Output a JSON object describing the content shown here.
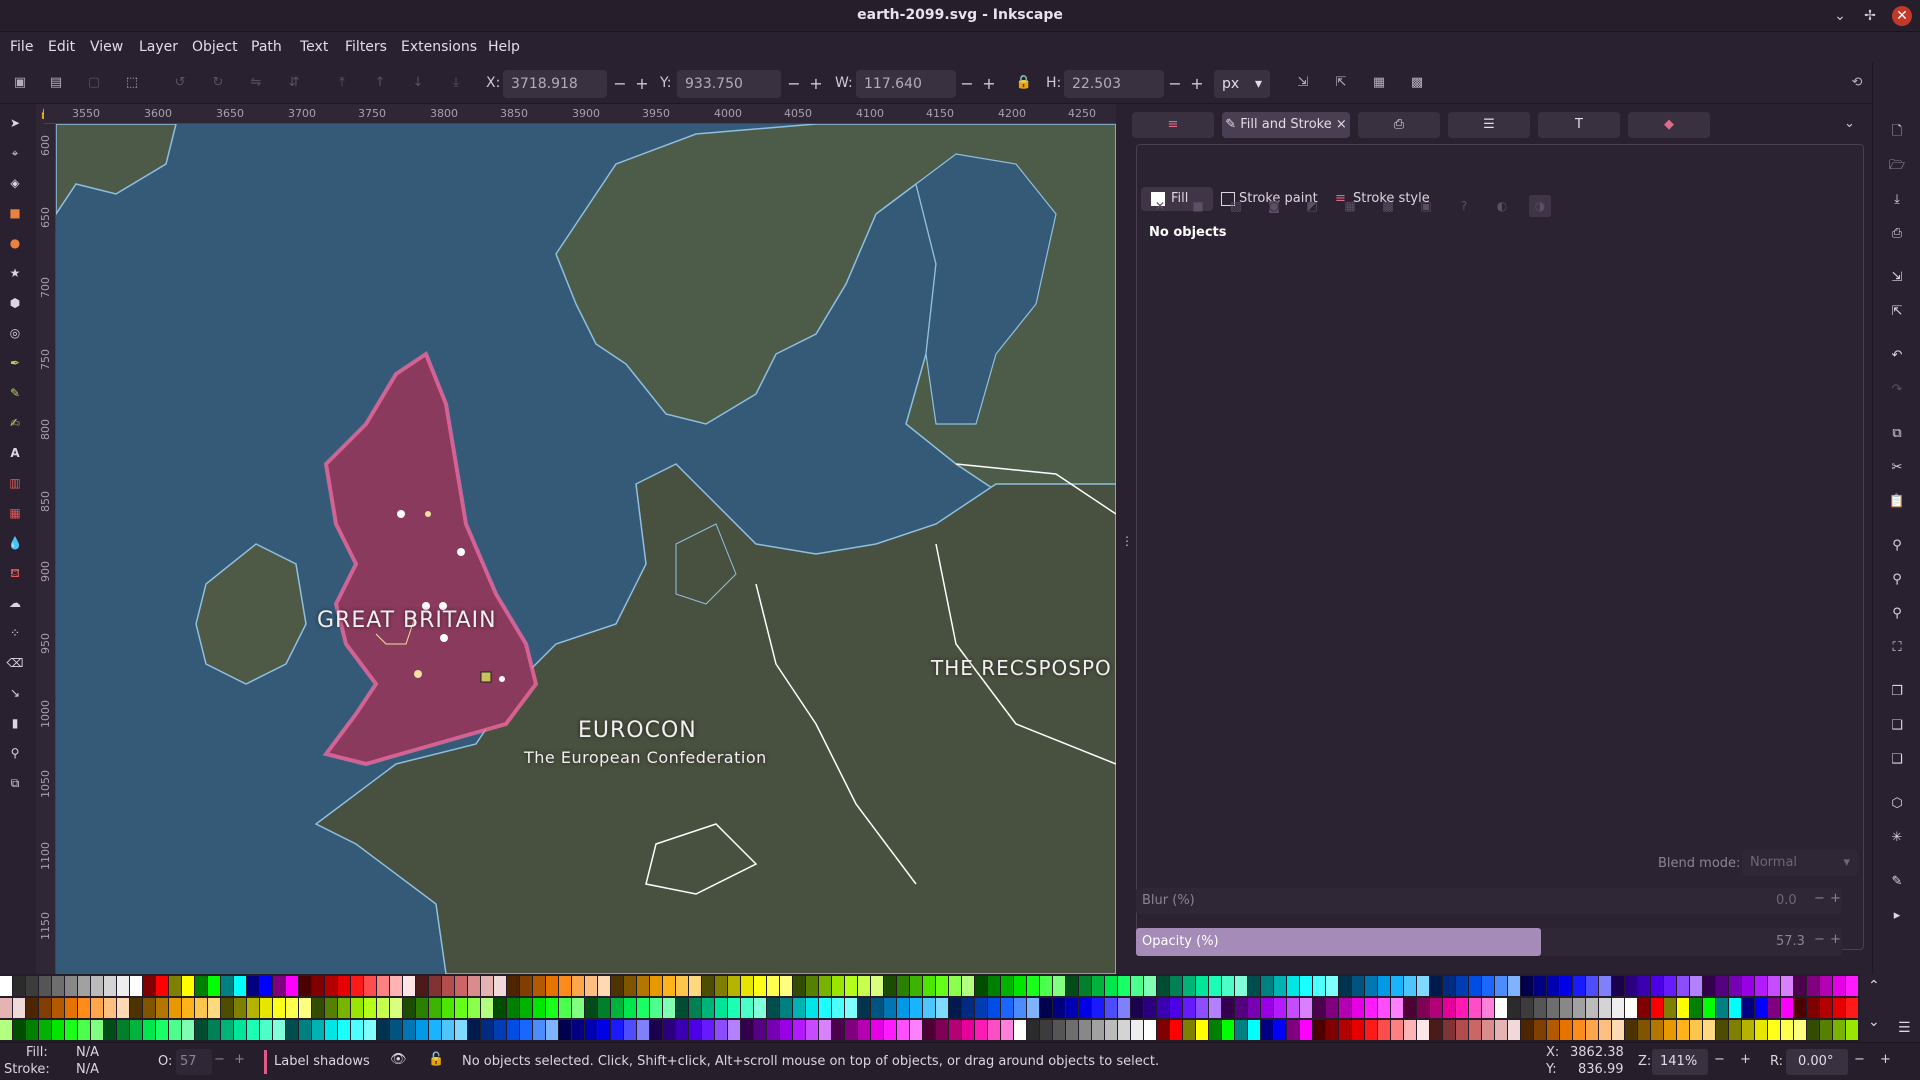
{
  "window": {
    "title": "earth-2099.svg - Inkscape"
  },
  "menu": [
    "File",
    "Edit",
    "View",
    "Layer",
    "Object",
    "Path",
    "Text",
    "Filters",
    "Extensions",
    "Help"
  ],
  "coords": {
    "x_label": "X:",
    "x": "3718.918",
    "y_label": "Y:",
    "y": "933.750",
    "w_label": "W:",
    "w": "117.640",
    "h_label": "H:",
    "h": "22.503",
    "unit": "px"
  },
  "ruler_top": [
    "3550",
    "3600",
    "3650",
    "3700",
    "3750",
    "3800",
    "3850",
    "3900",
    "3950",
    "4000",
    "4050",
    "4100",
    "4150",
    "4200",
    "4250"
  ],
  "ruler_left": [
    "600",
    "650",
    "700",
    "750",
    "800",
    "850",
    "900",
    "950",
    "1000",
    "1050",
    "1100",
    "1150"
  ],
  "map": {
    "label_gb": "GREAT BRITAIN",
    "label_eurocon": "EUROCON",
    "label_eurocon_sub": "The European Confederation",
    "label_east": "THE RECSPOSPO"
  },
  "panel": {
    "active_tab": "Fill and Stroke",
    "sub_fill": "Fill",
    "sub_stroke_paint": "Stroke paint",
    "sub_stroke_style": "Stroke style",
    "no_objects": "No objects",
    "blend_label": "Blend mode:",
    "blend_value": "Normal",
    "blur_label": "Blur (%)",
    "blur_value": "0.0",
    "opacity_label": "Opacity (%)",
    "opacity_value": "57.3",
    "opacity_fraction": 0.573
  },
  "status": {
    "fill_label": "Fill:",
    "fill_value": "N/A",
    "stroke_label": "Stroke:",
    "stroke_value": "N/A",
    "o_label": "O:",
    "o_value": "57",
    "layer": "Label shadows",
    "message": "No objects selected. Click, Shift+click, Alt+scroll mouse on top of objects, or drag around objects to select.",
    "x_label": "X:",
    "x": "3862.38",
    "y_label": "Y:",
    "y": "836.99",
    "z_label": "Z:",
    "zoom": "141%",
    "r_label": "R:",
    "rotation": "0.00°"
  },
  "palette_colors": [
    "#ffffff",
    "#2b2b2b",
    "#3c3c3c",
    "#555555",
    "#6e6e6e",
    "#888888",
    "#a1a1a1",
    "#bbbbbb",
    "#d4d4d4",
    "#eeeeee",
    "#ffffff",
    "#800000",
    "#ff0000",
    "#808000",
    "#ffff00",
    "#008000",
    "#00ff00",
    "#008080",
    "#00ffff",
    "#000080",
    "#0000ff",
    "#800080",
    "#ff00ff",
    "#4d0000",
    "#800000",
    "#b30000",
    "#e60000",
    "#ff1a1a",
    "#ff4d4d",
    "#ff8080",
    "#ffb3b3",
    "#ffe6e6",
    "#4d1a1a",
    "#803333",
    "#b34d4d",
    "#cc6666",
    "#d98c8c",
    "#e6b3b3",
    "#f2d9d9",
    "#4d2600",
    "#803f00",
    "#b35900",
    "#e67300",
    "#ff8c1a",
    "#ffa64d",
    "#ffbf80",
    "#ffd9b3",
    "#4d3300",
    "#805500",
    "#b37700",
    "#e69900",
    "#ffb31a",
    "#ffc64d",
    "#ffd980",
    "#4d4d00",
    "#808000",
    "#b3b300",
    "#e6e600",
    "#ffff1a",
    "#ffff4d",
    "#ffff80",
    "#334d00",
    "#558000",
    "#77b300",
    "#99e600",
    "#b3ff1a",
    "#c6ff4d",
    "#d9ff80",
    "#1a4d00",
    "#2b8000",
    "#3cb300",
    "#4de600",
    "#66ff1a",
    "#8cff4d",
    "#b3ff80",
    "#004d00",
    "#008000",
    "#00b300",
    "#00e600",
    "#1aff1a",
    "#4dff4d",
    "#80ff80",
    "#004d1a",
    "#00802b",
    "#00b33c",
    "#00e64d",
    "#1aff66",
    "#4dff8c",
    "#80ffb3",
    "#004d33",
    "#008055",
    "#00b377",
    "#00e699",
    "#1affb3",
    "#4dffc6",
    "#80ffd9",
    "#004d4d",
    "#008080",
    "#00b3b3",
    "#00e6e6",
    "#1affff",
    "#4dffff",
    "#80ffff",
    "#00334d",
    "#005580",
    "#0077b3",
    "#0099e6",
    "#1ab3ff",
    "#4dc6ff",
    "#80d9ff",
    "#001a4d",
    "#002b80",
    "#003cb3",
    "#004de6",
    "#1a66ff",
    "#4d8cff",
    "#80b3ff",
    "#00004d",
    "#000080",
    "#0000b3",
    "#0000e6",
    "#1a1aff",
    "#4d4dff",
    "#8080ff",
    "#1a004d",
    "#2b0080",
    "#3c00b3",
    "#4d00e6",
    "#661aff",
    "#8c4dff",
    "#b380ff",
    "#33004d",
    "#550080",
    "#7700b3",
    "#9900e6",
    "#b31aff",
    "#c64dff",
    "#d980ff",
    "#4d004d",
    "#800080",
    "#b300b3",
    "#e600e6",
    "#ff1aff",
    "#ff4dff",
    "#ff80ff",
    "#4d0033",
    "#800055",
    "#b30077",
    "#e60099",
    "#ff1ab3",
    "#ff4dc6",
    "#ff80d9"
  ]
}
